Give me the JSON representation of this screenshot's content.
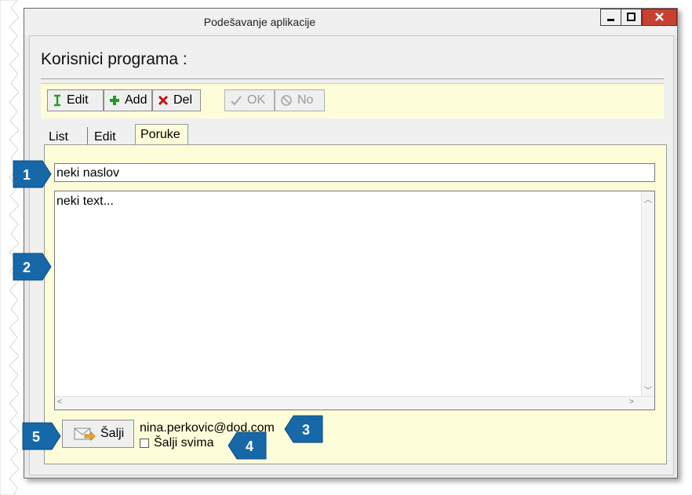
{
  "window": {
    "title": "Podešavanje aplikacije",
    "controls": {
      "minimize": "▁",
      "maximize": "◻",
      "close": "✕"
    }
  },
  "heading": "Korisnici programa :",
  "toolbar": {
    "edit_label": "Edit",
    "add_label": "Add",
    "del_label": "Del",
    "ok_label": "OK",
    "no_label": "No"
  },
  "tabs": [
    "List",
    "Edit",
    "Poruke"
  ],
  "message": {
    "subject": "neki naslov",
    "body": "neki text..."
  },
  "send": {
    "label": "Šalji",
    "email": "nina.perkovic@dod.com",
    "send_all_label": "Šalji svima"
  },
  "callouts": [
    "1",
    "2",
    "3",
    "4",
    "5"
  ],
  "colors": {
    "panel": "#fdfdd9",
    "callout": "#1668a8",
    "close_button": "#c84031"
  }
}
